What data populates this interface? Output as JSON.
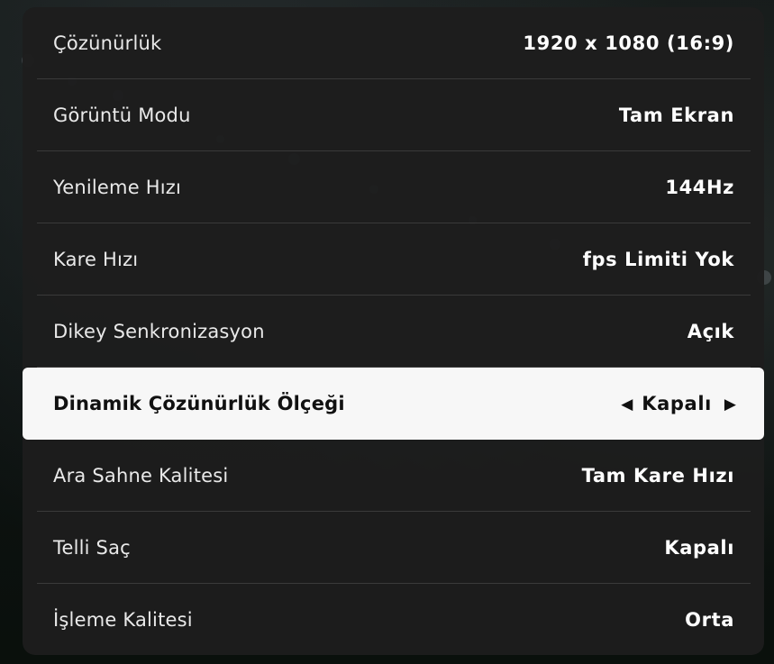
{
  "settings": [
    {
      "label": "Çözünürlük",
      "value": "1920 x 1080 (16:9)"
    },
    {
      "label": "Görüntü Modu",
      "value": "Tam Ekran"
    },
    {
      "label": "Yenileme Hızı",
      "value": "144Hz"
    },
    {
      "label": "Kare Hızı",
      "value": "fps Limiti Yok"
    },
    {
      "label": "Dikey Senkronizasyon",
      "value": "Açık"
    },
    {
      "label": "Dinamik Çözünürlük Ölçeği",
      "value": "Kapalı"
    },
    {
      "label": "Ara Sahne Kalitesi",
      "value": "Tam Kare Hızı"
    },
    {
      "label": "Telli Saç",
      "value": "Kapalı"
    },
    {
      "label": "İşleme Kalitesi",
      "value": "Orta"
    }
  ],
  "selected_index": 5,
  "icons": {
    "left_arrow": "caret-left-icon",
    "right_arrow": "caret-right-icon"
  },
  "colors": {
    "panel": "#1d1d1d",
    "selected_row": "#f7f7f7",
    "divider": "#3a3a3a",
    "text": "#ffffff"
  }
}
